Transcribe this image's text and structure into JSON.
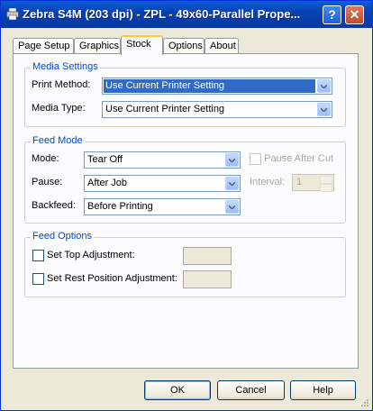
{
  "window": {
    "title": "Zebra S4M (203 dpi) - ZPL - 49x60-Parallel Prope...",
    "help_button": "?",
    "close_button": "✕"
  },
  "tabs": [
    {
      "label": "Page Setup",
      "active": false
    },
    {
      "label": "Graphics",
      "active": false
    },
    {
      "label": "Stock",
      "active": true
    },
    {
      "label": "Options",
      "active": false
    },
    {
      "label": "About",
      "active": false
    }
  ],
  "media_settings": {
    "legend": "Media Settings",
    "print_method_label": "Print Method:",
    "print_method_value": "Use Current Printer Setting",
    "media_type_label": "Media Type:",
    "media_type_value": "Use Current Printer Setting"
  },
  "feed_mode": {
    "legend": "Feed Mode",
    "mode_label": "Mode:",
    "mode_value": "Tear Off",
    "pause_label": "Pause:",
    "pause_value": "After Job",
    "backfeed_label": "Backfeed:",
    "backfeed_value": "Before Printing",
    "pause_after_cut_label": "Pause After Cut",
    "interval_label": "Interval:",
    "interval_value": "1"
  },
  "feed_options": {
    "legend": "Feed Options",
    "set_top_adjustment_label": "Set Top Adjustment:",
    "set_rest_position_label": "Set Rest Position Adjustment:",
    "set_top_adjustment_value": "",
    "set_rest_position_value": ""
  },
  "buttons": {
    "ok": "OK",
    "cancel": "Cancel",
    "help": "Help"
  },
  "colors": {
    "titlebar": "#0842b3",
    "group_legend": "#0046d5",
    "selection": "#316ac5"
  }
}
